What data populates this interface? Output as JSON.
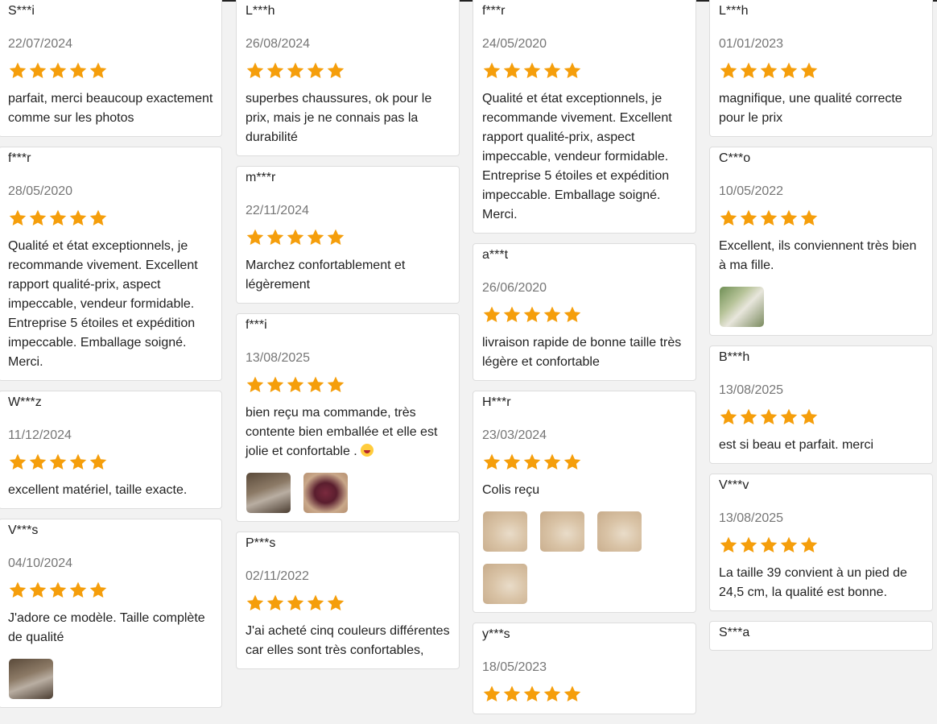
{
  "colors": {
    "star": "#f59e0b",
    "date": "#767676"
  },
  "columns": [
    [
      {
        "name": "S***i",
        "date": "22/07/2024",
        "rating": 5,
        "text": "parfait, merci beaucoup exactement comme sur les photos",
        "photos": []
      },
      {
        "name": "f***r",
        "date": "28/05/2020",
        "rating": 5,
        "text": "Qualité et état exceptionnels, je recommande vivement. Excellent rapport qualité-prix, aspect impeccable, vendeur formidable. Entreprise 5 étoiles et expédition impeccable. Emballage soigné. Merci.",
        "photos": []
      },
      {
        "name": "W***z",
        "date": "11/12/2024",
        "rating": 5,
        "text": "excellent matériel, taille exacte.",
        "photos": []
      },
      {
        "name": "V***s",
        "date": "04/10/2024",
        "rating": 5,
        "text": "J'adore ce modèle. Taille complète de qualité",
        "photos": [
          "pack"
        ]
      }
    ],
    [
      {
        "name": "L***h",
        "date": "26/08/2024",
        "rating": 5,
        "text": "superbes chaussures, ok pour le prix, mais je ne connais pas la durabilité",
        "photos": []
      },
      {
        "name": "m***r",
        "date": "22/11/2024",
        "rating": 5,
        "text": "Marchez confortablement et légèrement",
        "photos": []
      },
      {
        "name": "f***i",
        "date": "13/08/2025",
        "rating": 5,
        "text": "bien reçu ma commande, très contente bien emballée et elle est jolie et confortable .",
        "emoji": true,
        "photos": [
          "pack",
          "shoe"
        ]
      },
      {
        "name": "P***s",
        "date": "02/11/2022",
        "rating": 5,
        "text": "J'ai acheté cinq couleurs différentes car elles sont très confortables,",
        "photos": []
      }
    ],
    [
      {
        "name": "f***r",
        "date": "24/05/2020",
        "rating": 5,
        "text": "Qualité et état exceptionnels, je recommande vivement. Excellent rapport qualité-prix, aspect impeccable, vendeur formidable. Entreprise 5 étoiles et expédition impeccable. Emballage soigné. Merci.",
        "photos": []
      },
      {
        "name": "a***t",
        "date": "26/06/2020",
        "rating": 5,
        "text": "livraison rapide de bonne taille très légère et confortable",
        "photos": []
      },
      {
        "name": "H***r",
        "date": "23/03/2024",
        "rating": 5,
        "text": "Colis reçu",
        "photos": [
          "sand",
          "sand",
          "sand",
          "sand"
        ]
      },
      {
        "name": "y***s",
        "date": "18/05/2023",
        "rating": 5,
        "text": "",
        "photos": []
      }
    ],
    [
      {
        "name": "L***h",
        "date": "01/01/2023",
        "rating": 5,
        "text": "magnifique, une qualité correcte pour le prix",
        "photos": []
      },
      {
        "name": "C***o",
        "date": "10/05/2022",
        "rating": 5,
        "text": "Excellent, ils conviennent très bien à ma fille.",
        "photos": [
          "green"
        ]
      },
      {
        "name": "B***h",
        "date": "13/08/2025",
        "rating": 5,
        "text": "est si beau et parfait. merci",
        "photos": []
      },
      {
        "name": "V***v",
        "date": "13/08/2025",
        "rating": 5,
        "text": "La taille 39 convient à un pied de 24,5 cm, la qualité est bonne.",
        "photos": []
      },
      {
        "name": "S***a",
        "date": "",
        "rating": 5,
        "text": "",
        "photos": []
      }
    ]
  ]
}
